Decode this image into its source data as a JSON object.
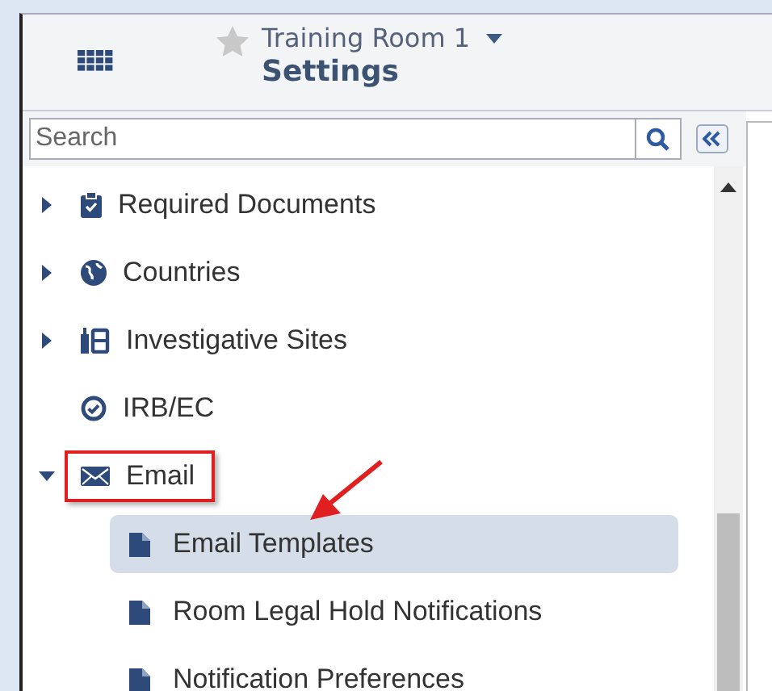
{
  "header": {
    "starred": false,
    "room": "Training Room 1",
    "title": "Settings"
  },
  "search": {
    "placeholder": "Search"
  },
  "tree": [
    {
      "label": "Required Documents",
      "kind": "clipboard",
      "expanded": false,
      "highlighted": false
    },
    {
      "label": "Countries",
      "kind": "globe",
      "expanded": false,
      "highlighted": false
    },
    {
      "label": "Investigative Sites",
      "kind": "sites",
      "expanded": false,
      "highlighted": false
    },
    {
      "label": "IRB/EC",
      "kind": "check",
      "highlighted": false
    },
    {
      "label": "Email",
      "kind": "envelope",
      "expanded": true,
      "highlighted": true,
      "children": [
        {
          "label": "Email Templates",
          "kind": "file",
          "selected": true,
          "arrow": true
        },
        {
          "label": "Room Legal Hold Notifications",
          "kind": "file",
          "selected": false,
          "arrow": false
        },
        {
          "label": "Notification Preferences",
          "kind": "file",
          "selected": false,
          "arrow": false
        }
      ]
    }
  ]
}
